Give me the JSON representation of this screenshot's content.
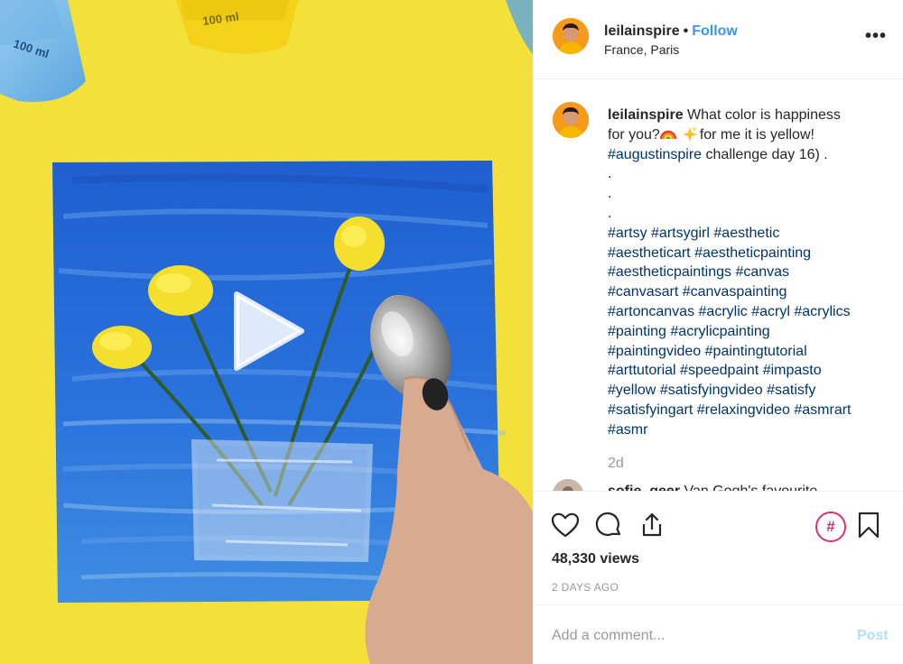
{
  "media": {
    "bottle_left_label": "100 ml",
    "bottle_center_label": "100 ml"
  },
  "header": {
    "username": "leilainspire",
    "separator": "•",
    "follow_label": "Follow",
    "location": "France, Paris",
    "more_label": "•••"
  },
  "caption": {
    "username": "leilainspire",
    "text_1": "What color is happiness",
    "text_2a": "for you?",
    "text_2b": "for me it is yellow!",
    "tag_challenge": "#augustinspire",
    "text_3": " challenge day 16) .",
    "dots": [
      ".",
      ".",
      "."
    ],
    "hashtag_lines": [
      [
        "#artsy",
        "#artsygirl",
        "#aesthetic"
      ],
      [
        "#aestheticart",
        "#aestheticpainting"
      ],
      [
        "#aestheticpaintings",
        "#canvas"
      ],
      [
        "#canvasart",
        "#canvaspainting"
      ],
      [
        "#artoncanvas",
        "#acrylic",
        "#acryl",
        "#acrylics"
      ],
      [
        "#painting",
        "#acrylicpainting"
      ],
      [
        "#paintingvideo",
        "#paintingtutorial"
      ],
      [
        "#arttutorial",
        "#speedpaint",
        "#impasto"
      ],
      [
        "#yellow",
        "#satisfyingvideo",
        "#satisfy"
      ],
      [
        "#satisfyingart",
        "#relaxingvideo",
        "#asmrart"
      ],
      [
        "#asmr"
      ]
    ],
    "age": "2d"
  },
  "next_comment": {
    "username": "sofie_geer",
    "text": "Van Gogh's favourite"
  },
  "stats": {
    "views": "48,330 views",
    "timestamp": "2 DAYS AGO"
  },
  "comment_box": {
    "placeholder": "Add a comment...",
    "post_label": "Post"
  },
  "colors": {
    "link_blue": "#3897f0",
    "hashtag_blue": "#003569",
    "muted_grey": "#999999",
    "post_disabled": "#b2dffc",
    "hashtag_pink": "#e1306c"
  },
  "icons": [
    "play-icon",
    "more-icon",
    "heart-icon",
    "comment-icon",
    "share-icon",
    "hashtag-icon",
    "bookmark-icon",
    "rainbow-emoji-icon",
    "sparkles-emoji-icon"
  ]
}
